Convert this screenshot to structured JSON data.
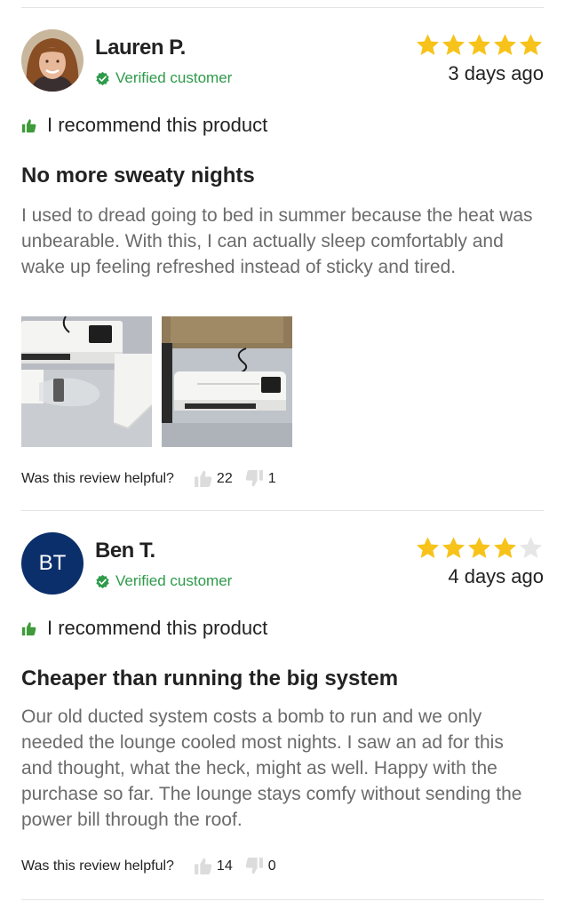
{
  "reviews": [
    {
      "name": "Lauren P.",
      "verified_label": "Verified customer",
      "rating": 5,
      "date": "3 days ago",
      "recommend_text": "I recommend this product",
      "title": "No more sweaty nights",
      "body": "I used to dread going to bed in summer because the heat was unbearable. With this, I can actually sleep comfortably and wake up feeling refreshed instead of sticky and tired.",
      "helpful_label": "Was this review helpful?",
      "up_count": "22",
      "down_count": "1"
    },
    {
      "name": "Ben T.",
      "initials": "BT",
      "verified_label": "Verified customer",
      "rating": 4,
      "date": "4 days ago",
      "recommend_text": "I recommend this product",
      "title": "Cheaper than running the big system",
      "body": "Our old ducted system costs a bomb to run and we only needed the lounge cooled most nights. I saw an ad for this and thought, what the heck, might as well. Happy with the purchase so far. The lounge stays comfy without sending the power bill through the roof.",
      "helpful_label": "Was this review helpful?",
      "up_count": "14",
      "down_count": "0"
    }
  ],
  "colors": {
    "star_filled": "#f7c31a",
    "star_empty": "#e6e6e6",
    "verified_green": "#2e9a4a",
    "recommend_green": "#3f9a3a",
    "avatar_blue": "#0b2f6b"
  }
}
